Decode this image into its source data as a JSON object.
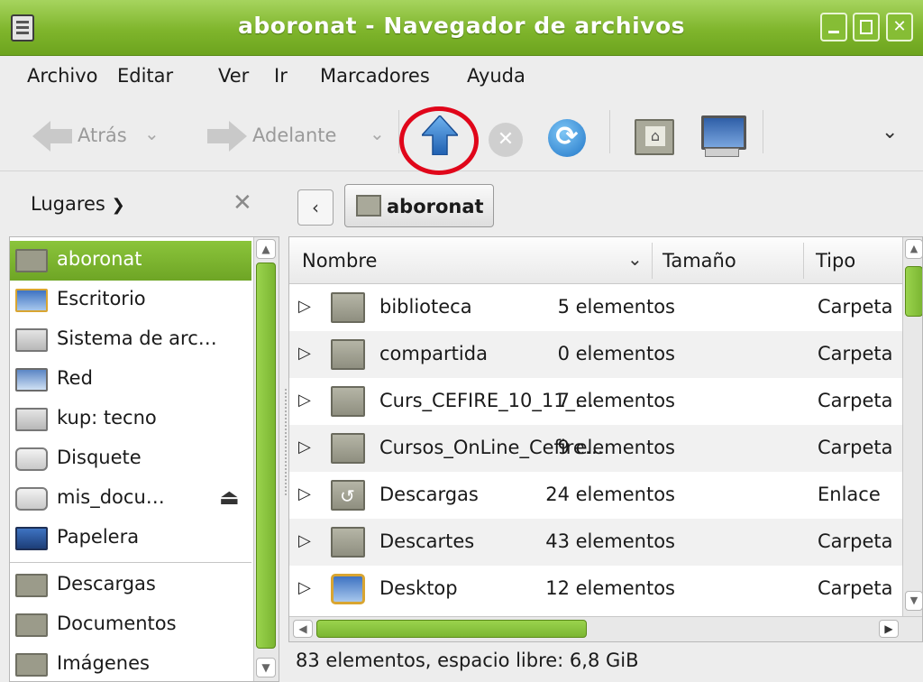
{
  "window": {
    "title": "aboronat - Navegador de archivos"
  },
  "menubar": {
    "items": [
      "Archivo",
      "Editar",
      "Ver",
      "Ir",
      "Marcadores",
      "Ayuda"
    ]
  },
  "toolbar": {
    "back_label": "Atrás",
    "forward_label": "Adelante",
    "up_button_highlighted": true,
    "highlight_color": "#e0061a"
  },
  "pathbar": {
    "current_folder": "aboronat"
  },
  "sidebar": {
    "header_label": "Lugares",
    "items": [
      {
        "label": "aboronat",
        "icon": "home-folder-icon",
        "selected": true
      },
      {
        "label": "Escritorio",
        "icon": "desktop-icon"
      },
      {
        "label": "Sistema de arc…",
        "icon": "drive-icon"
      },
      {
        "label": "Red",
        "icon": "network-icon"
      },
      {
        "label": "kup: tecno",
        "icon": "drive-icon"
      },
      {
        "label": "Disquete",
        "icon": "floppy-icon"
      },
      {
        "label": "mis_docu…",
        "icon": "drive-icon",
        "ejectable": true
      },
      {
        "label": "Papelera",
        "icon": "trash-icon"
      },
      {
        "label": "Descargas",
        "icon": "folder-icon"
      },
      {
        "label": "Documentos",
        "icon": "folder-icon"
      },
      {
        "label": "Imágenes",
        "icon": "folder-icon"
      }
    ]
  },
  "filelist": {
    "columns": {
      "name": "Nombre",
      "size": "Tamaño",
      "type": "Tipo"
    },
    "rows": [
      {
        "name": "biblioteca",
        "size": "5 elementos",
        "type": "Carpeta",
        "icon": "folder-icon"
      },
      {
        "name": "compartida",
        "size": "0 elementos",
        "type": "Carpeta",
        "icon": "folder-icon"
      },
      {
        "name": "Curs_CEFIRE_10_11_…",
        "size": "7 elementos",
        "type": "Carpeta",
        "icon": "folder-icon"
      },
      {
        "name": "Cursos_OnLine_Cefire…",
        "size": "9 elementos",
        "type": "Carpeta",
        "icon": "folder-icon"
      },
      {
        "name": "Descargas",
        "size": "24 elementos",
        "type": "Enlace",
        "icon": "folder-link-icon"
      },
      {
        "name": "Descartes",
        "size": "43 elementos",
        "type": "Carpeta",
        "icon": "folder-icon"
      },
      {
        "name": "Desktop",
        "size": "12 elementos",
        "type": "Carpeta",
        "icon": "desktop-folder-icon"
      }
    ]
  },
  "statusbar": {
    "text": "83 elementos, espacio libre: 6,8 GiB"
  },
  "colors": {
    "accent": "#7fb52c",
    "selection": "#6ea525"
  }
}
